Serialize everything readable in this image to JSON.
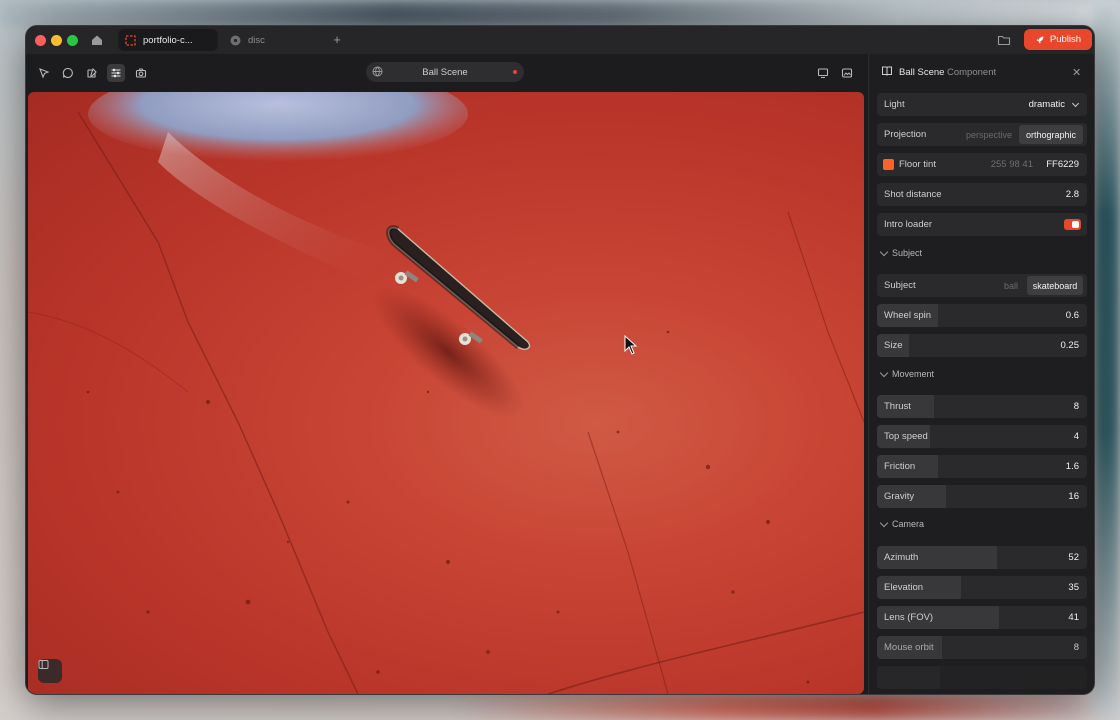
{
  "tabs": [
    {
      "label": "portfolio-c...",
      "active": true
    },
    {
      "label": "disc",
      "active": false
    }
  ],
  "titlebar": {
    "publish_label": "Publish",
    "accent": "#e8472c"
  },
  "toolbar": {
    "scene_name": "Ball Scene"
  },
  "panel": {
    "title": "Ball Scene",
    "subtitle": "Component",
    "light": {
      "label": "Light",
      "value": "dramatic"
    },
    "projection": {
      "label": "Projection",
      "options": [
        "perspective",
        "orthographic"
      ],
      "selected": "orthographic"
    },
    "floor_tint": {
      "label": "Floor tint",
      "rgb": "255 98 41",
      "hex": "FF6229",
      "color": "#ff6229"
    },
    "shot_distance": {
      "label": "Shot distance",
      "value": "2.8",
      "fraction": 0.0
    },
    "intro_loader": {
      "label": "Intro loader",
      "on": true
    },
    "sections": {
      "subject": "Subject",
      "movement": "Movement",
      "camera": "Camera"
    },
    "subject": {
      "label": "Subject",
      "options": [
        "ball",
        "skateboard"
      ],
      "selected": "skateboard"
    },
    "wheel_spin": {
      "label": "Wheel spin",
      "value": "0.6",
      "fraction": 0.29
    },
    "size": {
      "label": "Size",
      "value": "0.25",
      "fraction": 0.15
    },
    "thrust": {
      "label": "Thrust",
      "value": "8",
      "fraction": 0.27
    },
    "top_speed": {
      "label": "Top speed",
      "value": "4",
      "fraction": 0.25
    },
    "friction": {
      "label": "Friction",
      "value": "1.6",
      "fraction": 0.29
    },
    "gravity": {
      "label": "Gravity",
      "value": "16",
      "fraction": 0.33
    },
    "azimuth": {
      "label": "Azimuth",
      "value": "52",
      "fraction": 0.57
    },
    "elevation": {
      "label": "Elevation",
      "value": "35",
      "fraction": 0.4
    },
    "lens_fov": {
      "label": "Lens (FOV)",
      "value": "41",
      "fraction": 0.58
    },
    "mouse_orbit": {
      "label": "Mouse orbit",
      "value": "8",
      "fraction": 0.31
    }
  }
}
